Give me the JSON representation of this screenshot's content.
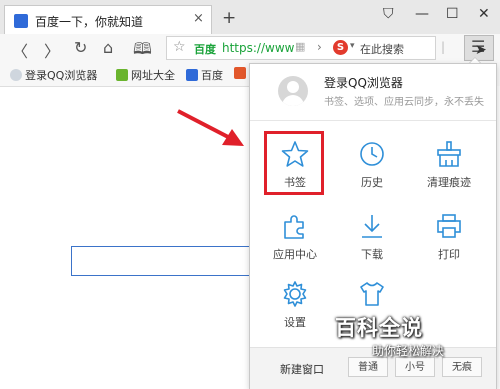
{
  "tab": {
    "title": "百度一下，你就知道",
    "close": "×",
    "new_tab": "+"
  },
  "window_controls": {
    "skin": "⛉",
    "minimize": "—",
    "maximize": "☐",
    "close": "✕"
  },
  "nav": {
    "back": "〈",
    "forward": "〉",
    "reload": "↻",
    "home": "⌂",
    "reader": "🕮",
    "site_badge": "百度",
    "url": "https://www",
    "search_placeholder": "在此搜索",
    "search_engine_letter": "S"
  },
  "bookmarks_bar": [
    {
      "label": "登录QQ浏览器",
      "color": "#cfd6de"
    },
    {
      "label": "网址大全",
      "color": "#6ab42e"
    },
    {
      "label": "百度",
      "color": "#2f6ad8"
    },
    {
      "label": "",
      "color": "#e2572b"
    }
  ],
  "menu": {
    "login_title": "登录QQ浏览器",
    "login_subtitle": "书签、选项、应用云同步，永不丢失",
    "items": [
      {
        "label": "书签",
        "icon": "star-icon"
      },
      {
        "label": "历史",
        "icon": "clock-icon"
      },
      {
        "label": "清理痕迹",
        "icon": "broom-icon"
      },
      {
        "label": "应用中心",
        "icon": "puzzle-icon"
      },
      {
        "label": "下载",
        "icon": "download-icon"
      },
      {
        "label": "打印",
        "icon": "printer-icon"
      },
      {
        "label": "设置",
        "icon": "gear-icon"
      },
      {
        "label": "",
        "icon": "shirt-icon"
      }
    ],
    "new_window": "新建窗口",
    "zoom_options": [
      "普通",
      "小号",
      "无痕"
    ]
  },
  "watermark": {
    "title": "百科全说",
    "subtitle": "助你轻松解决"
  },
  "colors": {
    "accent": "#2f8fd8",
    "highlight": "#e0202a",
    "url_green": "#1aa33a"
  }
}
